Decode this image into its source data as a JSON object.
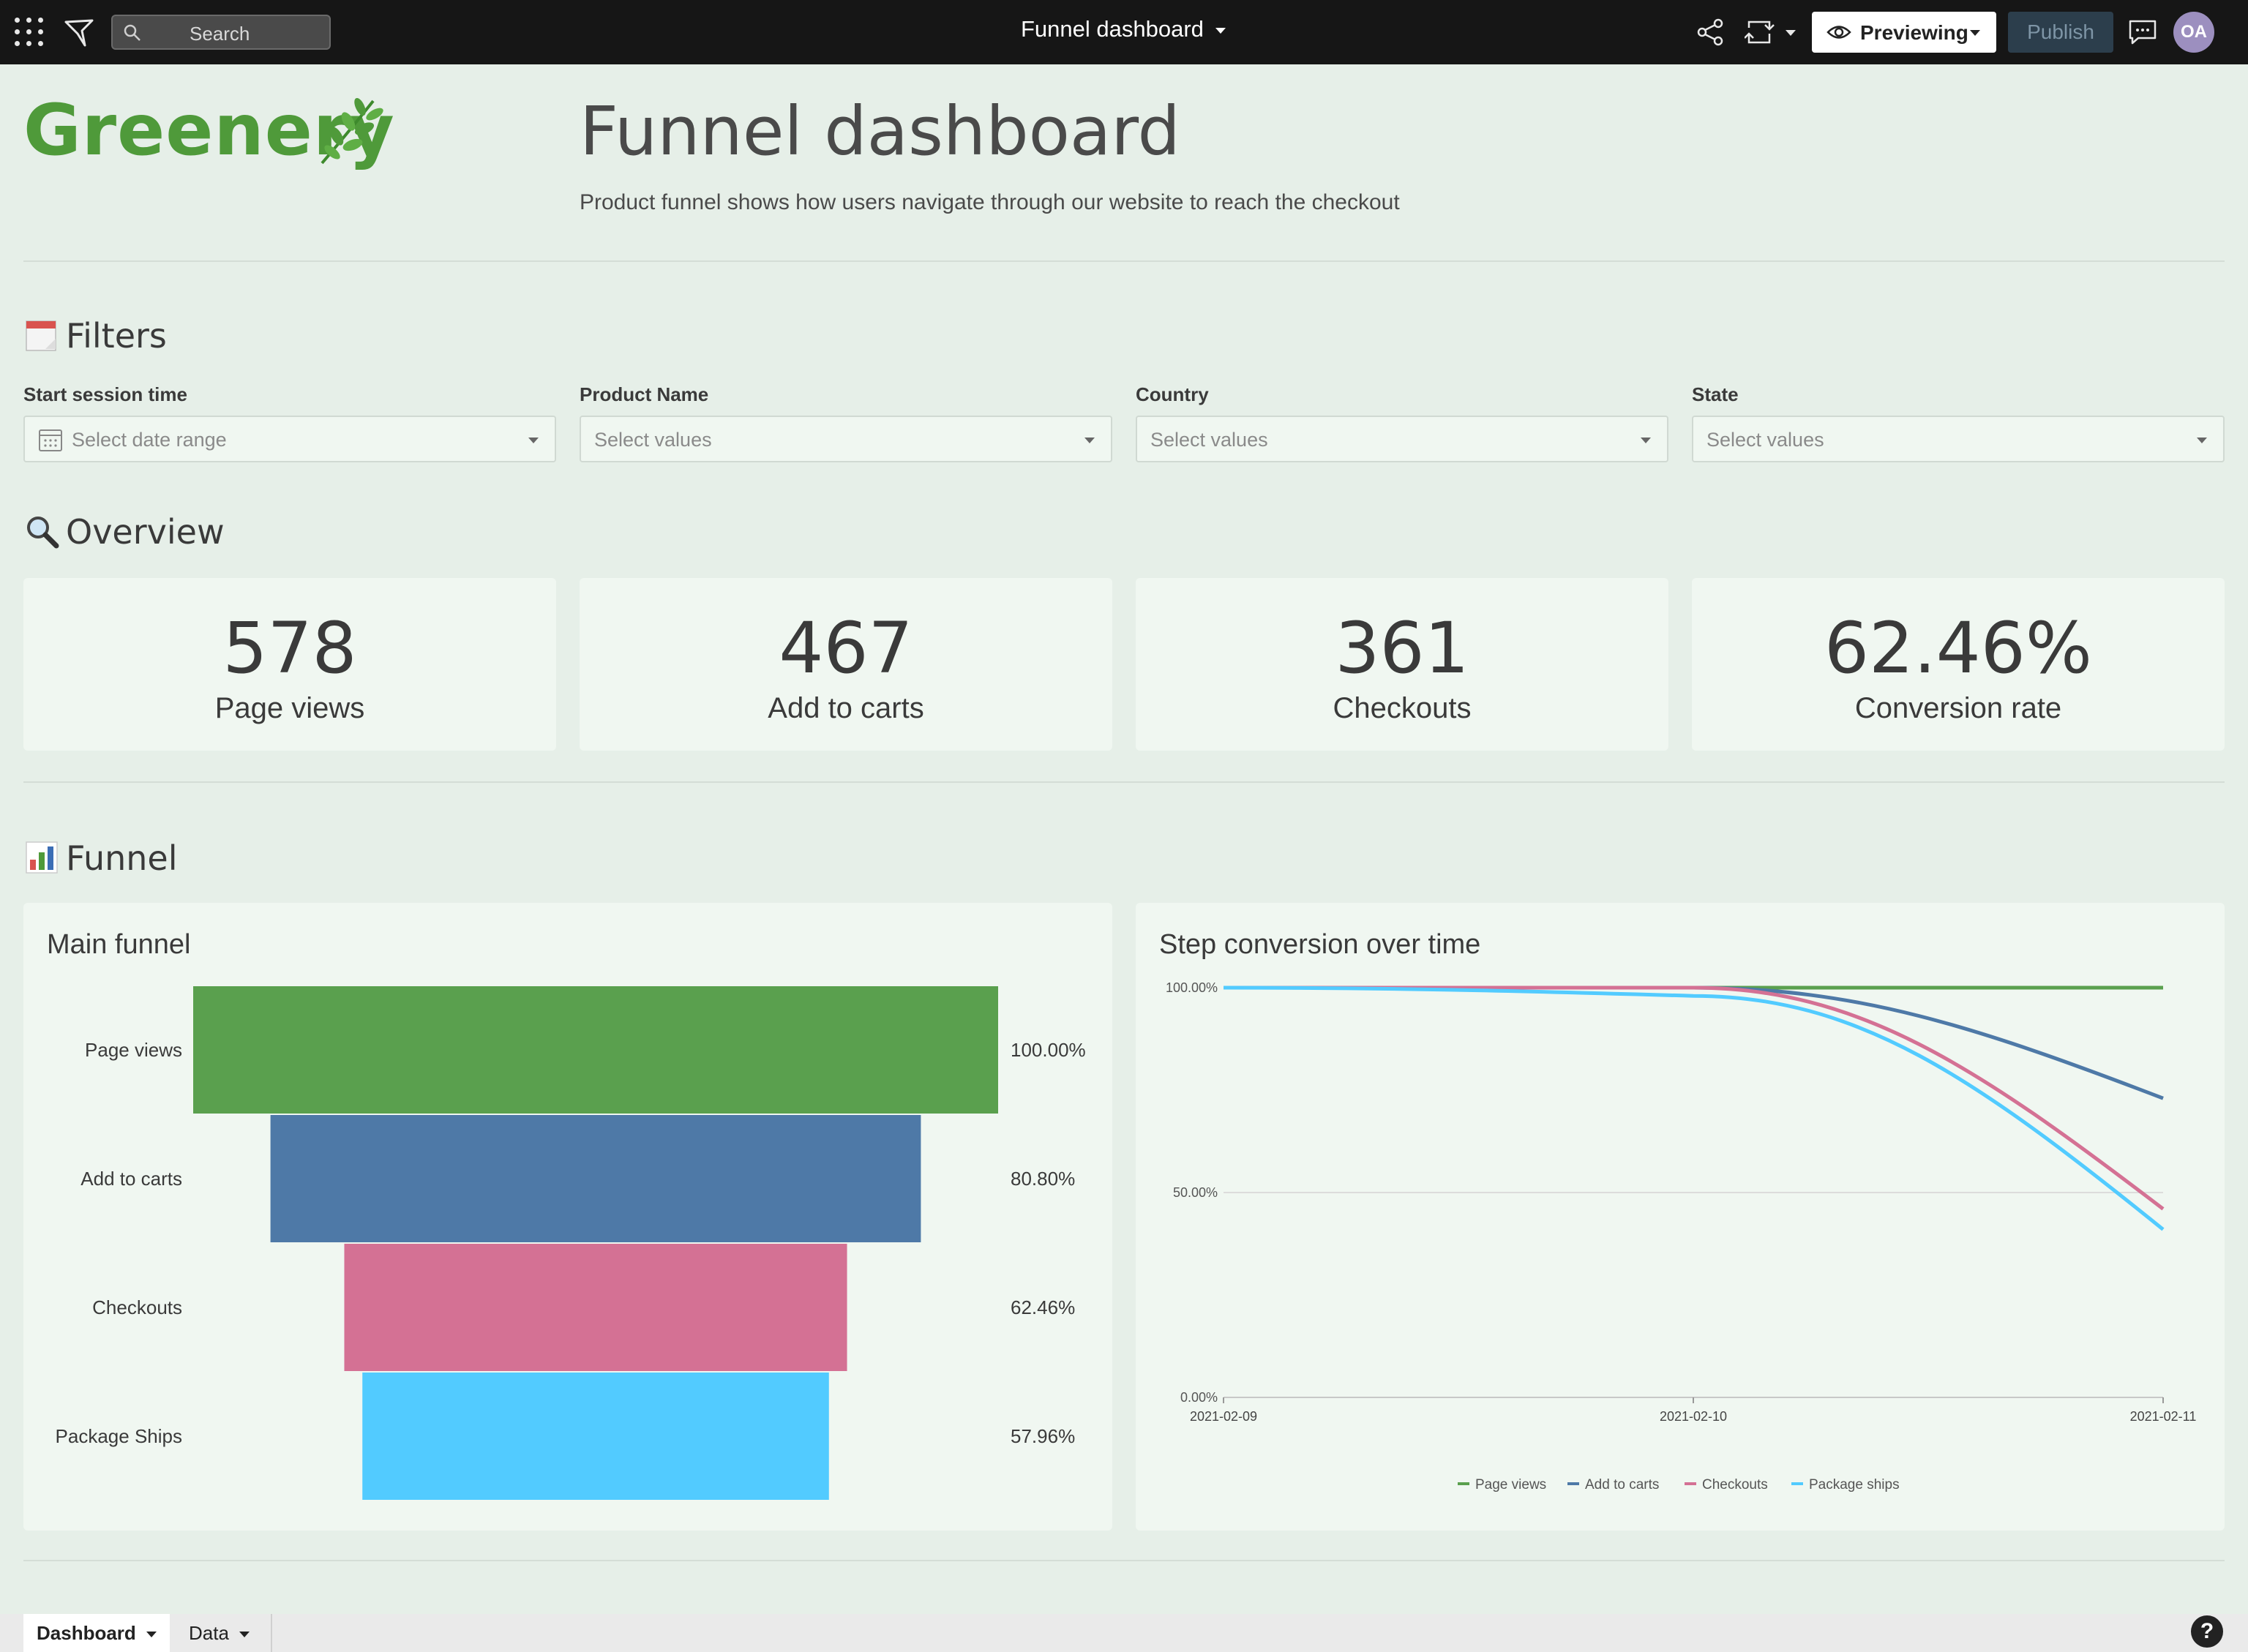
{
  "topbar": {
    "search_label": "Search",
    "doc_title": "Funnel dashboard",
    "preview_label": "Previewing",
    "publish_label": "Publish",
    "avatar_initials": "OA"
  },
  "header": {
    "brand": "Greenery",
    "title": "Funnel dashboard",
    "subtitle": "Product funnel shows how users navigate through our website to reach the checkout"
  },
  "filters": {
    "heading": "Filters",
    "items": [
      {
        "label": "Start session time",
        "placeholder": "Select date range"
      },
      {
        "label": "Product Name",
        "placeholder": "Select values"
      },
      {
        "label": "Country",
        "placeholder": "Select values"
      },
      {
        "label": "State",
        "placeholder": "Select values"
      }
    ]
  },
  "overview": {
    "heading": "Overview",
    "kpis": [
      {
        "value": "578",
        "caption": "Page views"
      },
      {
        "value": "467",
        "caption": "Add to carts"
      },
      {
        "value": "361",
        "caption": "Checkouts"
      },
      {
        "value": "62.46%",
        "caption": "Conversion rate"
      }
    ]
  },
  "funnel_section": {
    "heading": "Funnel"
  },
  "colors": {
    "page_views": "#5aa04e",
    "add_to_carts": "#4e79a7",
    "checkouts": "#d47194",
    "package_ships": "#52cbff",
    "brand_green": "#4f9a3a"
  },
  "chart_data": [
    {
      "type": "bar",
      "title": "Main funnel",
      "categories": [
        "Page views",
        "Add to carts",
        "Checkouts",
        "Package Ships"
      ],
      "values": [
        100.0,
        80.8,
        62.46,
        57.96
      ],
      "value_labels": [
        "100.00%",
        "80.80%",
        "62.46%",
        "57.96%"
      ],
      "unit": "%"
    },
    {
      "type": "line",
      "title": "Step conversion over time",
      "x": [
        "2021-02-09",
        "2021-02-10",
        "2021-02-11"
      ],
      "ylim": [
        0,
        100
      ],
      "yticks": [
        "0.00%",
        "50.00%",
        "100.00%"
      ],
      "series": [
        {
          "name": "Page views",
          "values": [
            100,
            100,
            100
          ]
        },
        {
          "name": "Add to carts",
          "values": [
            100,
            100,
            73
          ]
        },
        {
          "name": "Checkouts",
          "values": [
            100,
            100,
            46
          ]
        },
        {
          "name": "Package ships",
          "values": [
            100,
            98,
            41
          ]
        }
      ],
      "legend": "bottom"
    }
  ],
  "bottom_tabs": [
    {
      "label": "Dashboard"
    },
    {
      "label": "Data"
    }
  ],
  "help_label": "?"
}
